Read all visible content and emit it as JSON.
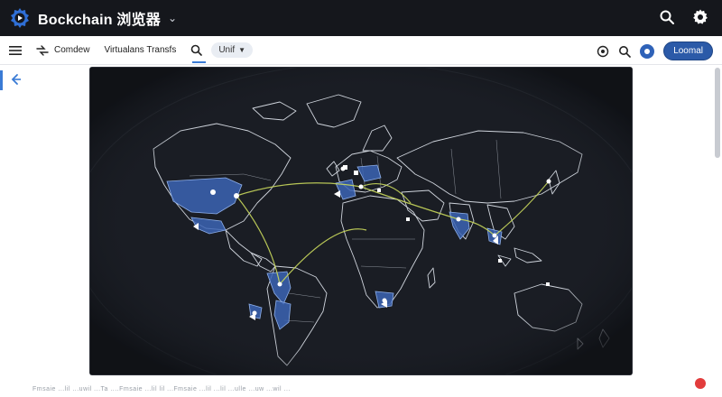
{
  "app": {
    "title": "Bockchain 浏览器"
  },
  "toolbar": {
    "overview_label": "Comdew",
    "transfers_label": "Virtualans Transfs",
    "unit_label": "Unif",
    "load_label": "Loomal"
  },
  "footer": {
    "text": "Fmsaie ...lil ...uwil ...Ta ....Fmsaie ...lil lil ...Fmsaie ...lil ...lil ...ulle ...uw ...wil ..."
  },
  "colors": {
    "topbar_bg": "#15171c",
    "map_bg": "#1a1d24",
    "land_stroke": "#cfd4dc",
    "highlight_fill": "#3c64b4",
    "route_color": "#c9d85c",
    "accent": "#3a7bd5",
    "record_dot": "#e23c3c"
  },
  "icons": {
    "logo": "blockchain-logo-icon",
    "search": "search-icon",
    "settings": "gear-icon",
    "menu": "hamburger-icon",
    "back": "arrow-left-icon"
  }
}
